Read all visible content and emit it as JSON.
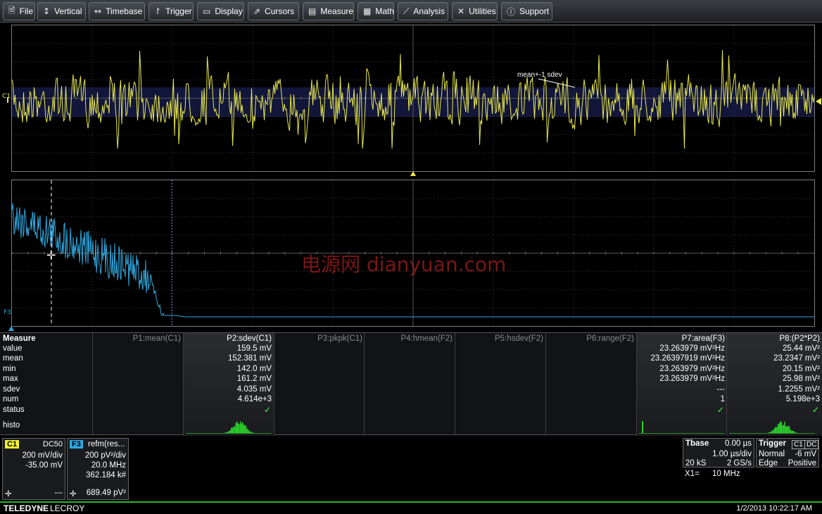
{
  "menu": [
    {
      "label": "File",
      "icon": "file-icon"
    },
    {
      "label": "Vertical",
      "icon": "vertical-icon"
    },
    {
      "label": "Timebase",
      "icon": "timebase-icon"
    },
    {
      "label": "Trigger",
      "icon": "trigger-icon"
    },
    {
      "label": "Display",
      "icon": "display-icon"
    },
    {
      "label": "Cursors",
      "icon": "cursors-icon"
    },
    {
      "label": "Measure",
      "icon": "measure-icon"
    },
    {
      "label": "Math",
      "icon": "math-icon"
    },
    {
      "label": "Analysis",
      "icon": "analysis-icon"
    },
    {
      "label": "Utilities",
      "icon": "utilities-icon"
    },
    {
      "label": "Support",
      "icon": "support-icon"
    }
  ],
  "upper_grid": {
    "channel_label": "C1",
    "annotation": "mean+-1 sdev",
    "trace_color": "#e8e84a"
  },
  "lower_grid": {
    "channel_label": "F3",
    "trace_color": "#2fa8e0"
  },
  "watermark": "电源网  dianyuan.com",
  "measure": {
    "title": "Measure",
    "row_labels": [
      "value",
      "mean",
      "min",
      "max",
      "sdev",
      "num",
      "status",
      "histo"
    ],
    "columns": [
      {
        "header": "P1:mean(C1)",
        "active": false,
        "values": []
      },
      {
        "header": "P2:sdev(C1)",
        "active": true,
        "values": [
          "159.5 mV",
          "152.381 mV",
          "142.0 mV",
          "161.2 mV",
          "4.035 mV",
          "4.614e+3"
        ],
        "status": true,
        "histo": "wide"
      },
      {
        "header": "P3:pkpk(C1)",
        "active": false,
        "values": []
      },
      {
        "header": "P4:hmean(F2)",
        "active": false,
        "values": []
      },
      {
        "header": "P5:hsdev(F2)",
        "active": false,
        "values": []
      },
      {
        "header": "P6:range(F2)",
        "active": false,
        "values": []
      },
      {
        "header": "P7:area(F3)",
        "active": true,
        "values": [
          "23.263979 mV²Hz",
          "23.26397919 mV²Hz",
          "23.263979 mV²Hz",
          "23.263979 mV²Hz",
          "---",
          "1"
        ],
        "status": true,
        "histo": "spike"
      },
      {
        "header": "P8:(P2*P2)",
        "active": true,
        "values": [
          "25.44 mV²",
          "23.2347 mV²",
          "20.15 mV²",
          "25.98 mV²",
          "1.2255 mV²",
          "5.198e+3"
        ],
        "status": true,
        "histo": "wide"
      }
    ]
  },
  "c1_desc": {
    "tag": "C1",
    "coupling": "DC50",
    "vdiv": "200 mV/div",
    "offset": "-35.00 mV",
    "dash": "---",
    "color": "#f0f030"
  },
  "f3_desc": {
    "tag": "F3",
    "title": "refm(res...",
    "vdiv": "200 pV²/div",
    "freq": "20.0 MHz",
    "count": "362.184 k#",
    "value": "689.49 pV²",
    "color": "#2fa8e0"
  },
  "tbase": {
    "title": "Tbase",
    "delay": "0.00 µs",
    "tdiv": "1.00 µs/div",
    "samples": "20 kS",
    "rate": "2 GS/s",
    "x1_label": "X1=",
    "x1_value": "10 MHz"
  },
  "trigger": {
    "title": "Trigger",
    "source": "C1",
    "coupling": "DC",
    "mode": "Normal",
    "level": "-6 mV",
    "type": "Edge",
    "slope": "Positive"
  },
  "footer": {
    "brand_bold": "TELEDYNE",
    "brand": "LECROY",
    "datetime": "1/2/2013 10:22:17 AM"
  }
}
